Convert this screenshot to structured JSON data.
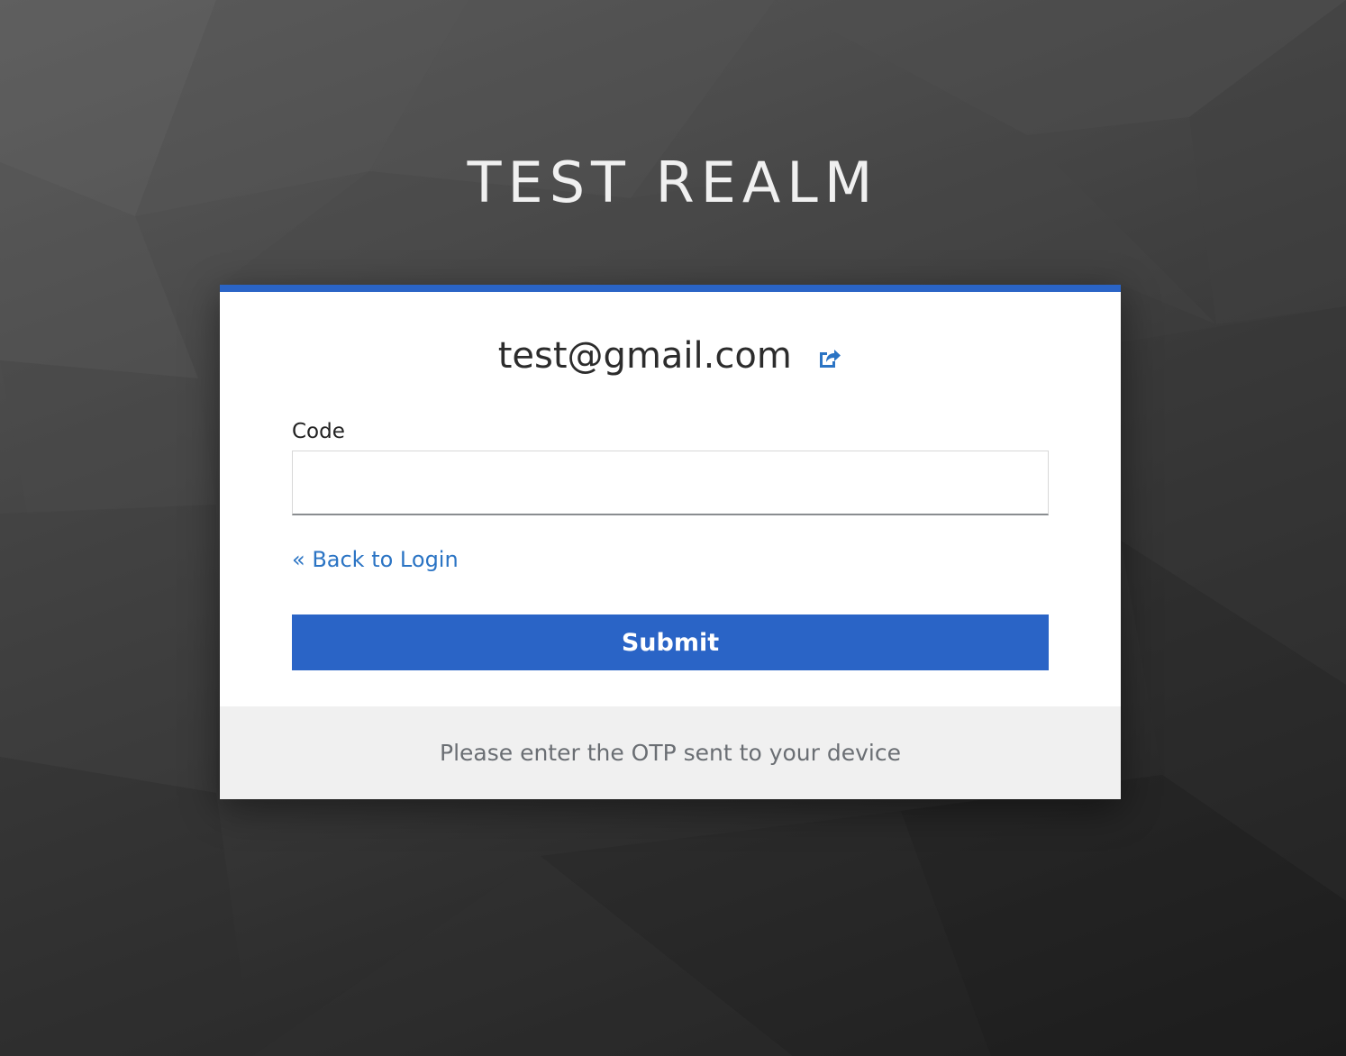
{
  "realm": {
    "title": "TEST REALM"
  },
  "login": {
    "username": "test@gmail.com",
    "restart_icon": "share-square-icon",
    "code_label": "Code",
    "code_value": "",
    "back_link": "« Back to Login",
    "submit_label": "Submit",
    "info_text": "Please enter the OTP sent to your device"
  },
  "colors": {
    "accent": "#2a64c6",
    "link": "#2b74c4",
    "footer_bg": "#f0f0f0",
    "footer_text": "#6a6e73"
  }
}
